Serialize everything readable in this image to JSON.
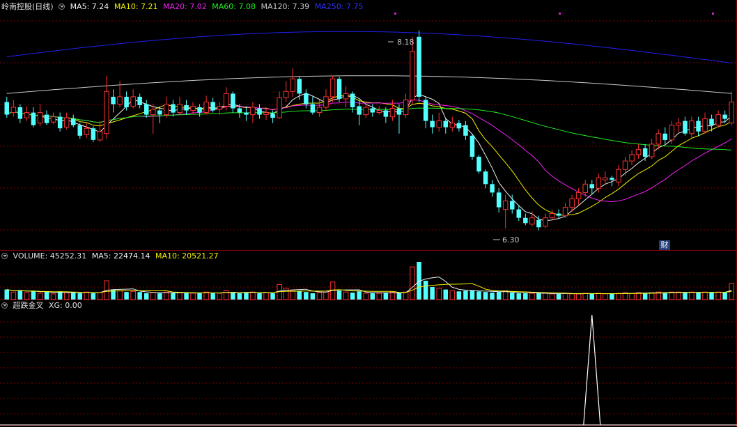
{
  "header": {
    "title": "岭南控股(日线)",
    "ma": [
      {
        "label": "MA5: 7.24",
        "color": "#f0f0f0"
      },
      {
        "label": "MA10: 7.21",
        "color": "#f0f000"
      },
      {
        "label": "MA20: 7.02",
        "color": "#f020f0"
      },
      {
        "label": "MA60: 7.08",
        "color": "#20f020"
      },
      {
        "label": "MA120: 7.39",
        "color": "#c8c8c8"
      },
      {
        "label": "MA250: 7.75",
        "color": "#2020f0"
      }
    ]
  },
  "volume_header": {
    "label": "VOLUME: 45252.31",
    "ma5": "MA5: 22474.14",
    "ma10": "MA10: 20521.27"
  },
  "indicator_header": {
    "name": "超跌金叉",
    "value": "XG: 0.00"
  },
  "annotations": {
    "high": "8.18",
    "low": "6.30",
    "finance_badge": "财"
  },
  "colors": {
    "up": "#ff3232",
    "down": "#54ffff",
    "grid": "#800000",
    "ma5": "#f0f0f0",
    "ma10": "#f0f000",
    "ma20": "#f020f0",
    "ma60": "#20f020",
    "ma120": "#c8c8c8",
    "ma250": "#2020f0"
  },
  "chart_data": {
    "type": "candlestick",
    "price_range": [
      6.1,
      8.35
    ],
    "candles": [
      [
        7.5,
        7.38,
        7.55,
        7.35
      ],
      [
        7.4,
        7.45,
        7.52,
        7.36
      ],
      [
        7.45,
        7.34,
        7.48,
        7.3
      ],
      [
        7.35,
        7.4,
        7.46,
        7.32
      ],
      [
        7.4,
        7.28,
        7.45,
        7.26
      ],
      [
        7.3,
        7.4,
        7.48,
        7.27
      ],
      [
        7.38,
        7.3,
        7.42,
        7.28
      ],
      [
        7.31,
        7.36,
        7.4,
        7.29
      ],
      [
        7.36,
        7.25,
        7.4,
        7.22
      ],
      [
        7.26,
        7.35,
        7.4,
        7.24
      ],
      [
        7.34,
        7.28,
        7.38,
        7.26
      ],
      [
        7.28,
        7.18,
        7.3,
        7.15
      ],
      [
        7.19,
        7.25,
        7.3,
        7.16
      ],
      [
        7.25,
        7.14,
        7.27,
        7.12
      ],
      [
        7.14,
        7.22,
        7.32,
        7.12
      ],
      [
        7.2,
        7.6,
        7.75,
        7.15
      ],
      [
        7.55,
        7.48,
        7.62,
        7.4
      ],
      [
        7.48,
        7.55,
        7.7,
        7.45
      ],
      [
        7.55,
        7.45,
        7.6,
        7.42
      ],
      [
        7.46,
        7.55,
        7.62,
        7.44
      ],
      [
        7.55,
        7.47,
        7.58,
        7.44
      ],
      [
        7.48,
        7.38,
        7.52,
        7.35
      ],
      [
        7.38,
        7.43,
        7.48,
        7.2
      ],
      [
        7.42,
        7.38,
        7.46,
        7.3
      ],
      [
        7.38,
        7.48,
        7.55,
        7.35
      ],
      [
        7.48,
        7.4,
        7.52,
        7.36
      ],
      [
        7.4,
        7.48,
        7.55,
        7.38
      ],
      [
        7.47,
        7.42,
        7.52,
        7.38
      ],
      [
        7.42,
        7.46,
        7.5,
        7.38
      ],
      [
        7.45,
        7.4,
        7.48,
        7.36
      ],
      [
        7.4,
        7.5,
        7.56,
        7.38
      ],
      [
        7.5,
        7.42,
        7.54,
        7.4
      ],
      [
        7.43,
        7.46,
        7.5,
        7.38
      ],
      [
        7.46,
        7.58,
        7.64,
        7.42
      ],
      [
        7.58,
        7.44,
        7.6,
        7.4
      ],
      [
        7.44,
        7.4,
        7.48,
        7.35
      ],
      [
        7.4,
        7.38,
        7.46,
        7.32
      ],
      [
        7.38,
        7.45,
        7.5,
        7.3
      ],
      [
        7.44,
        7.38,
        7.48,
        7.34
      ],
      [
        7.38,
        7.4,
        7.45,
        7.33
      ],
      [
        7.39,
        7.35,
        7.42,
        7.3
      ],
      [
        7.35,
        7.54,
        7.6,
        7.34
      ],
      [
        7.54,
        7.6,
        7.7,
        7.5
      ],
      [
        7.6,
        7.72,
        7.82,
        7.55
      ],
      [
        7.72,
        7.58,
        7.74,
        7.52
      ],
      [
        7.58,
        7.48,
        7.62,
        7.44
      ],
      [
        7.48,
        7.4,
        7.55,
        7.38
      ],
      [
        7.4,
        7.45,
        7.52,
        7.36
      ],
      [
        7.45,
        7.55,
        7.62,
        7.42
      ],
      [
        7.55,
        7.72,
        7.75,
        7.5
      ],
      [
        7.72,
        7.53,
        7.74,
        7.5
      ],
      [
        7.53,
        7.58,
        7.65,
        7.45
      ],
      [
        7.58,
        7.45,
        7.6,
        7.4
      ],
      [
        7.46,
        7.38,
        7.52,
        7.28
      ],
      [
        7.38,
        7.45,
        7.48,
        7.35
      ],
      [
        7.44,
        7.4,
        7.48,
        7.36
      ],
      [
        7.4,
        7.42,
        7.46,
        7.38
      ],
      [
        7.42,
        7.36,
        7.45,
        7.3
      ],
      [
        7.36,
        7.44,
        7.52,
        7.32
      ],
      [
        7.44,
        7.38,
        7.48,
        7.2
      ],
      [
        7.38,
        7.52,
        7.58,
        7.35
      ],
      [
        7.52,
        7.98,
        8.12,
        7.48
      ],
      [
        8.12,
        7.55,
        8.18,
        7.5
      ],
      [
        7.52,
        7.32,
        7.55,
        7.25
      ],
      [
        7.32,
        7.26,
        7.38,
        7.2
      ],
      [
        7.26,
        7.32,
        7.4,
        7.22
      ],
      [
        7.32,
        7.26,
        7.35,
        7.2
      ],
      [
        7.26,
        7.3,
        7.36,
        7.22
      ],
      [
        7.3,
        7.25,
        7.33,
        7.22
      ],
      [
        7.28,
        7.18,
        7.32,
        7.14
      ],
      [
        7.18,
        6.98,
        7.2,
        6.95
      ],
      [
        6.98,
        6.84,
        7.0,
        6.82
      ],
      [
        6.84,
        6.72,
        6.86,
        6.68
      ],
      [
        6.72,
        6.64,
        6.76,
        6.6
      ],
      [
        6.64,
        6.5,
        6.68,
        6.45
      ],
      [
        6.48,
        6.56,
        6.62,
        6.3
      ],
      [
        6.56,
        6.48,
        6.62,
        6.44
      ],
      [
        6.48,
        6.4,
        6.52,
        6.37
      ],
      [
        6.4,
        6.35,
        6.44,
        6.33
      ],
      [
        6.34,
        6.4,
        6.46,
        6.32
      ],
      [
        6.38,
        6.31,
        6.42,
        6.28
      ],
      [
        6.32,
        6.4,
        6.44,
        6.3
      ],
      [
        6.4,
        6.44,
        6.48,
        6.38
      ],
      [
        6.44,
        6.42,
        6.48,
        6.4
      ],
      [
        6.42,
        6.5,
        6.54,
        6.4
      ],
      [
        6.5,
        6.58,
        6.62,
        6.46
      ],
      [
        6.58,
        6.64,
        6.68,
        6.52
      ],
      [
        6.64,
        6.72,
        6.76,
        6.6
      ],
      [
        6.72,
        6.68,
        6.76,
        6.62
      ],
      [
        6.68,
        6.78,
        6.82,
        6.64
      ],
      [
        6.76,
        6.78,
        6.84,
        6.72
      ],
      [
        6.78,
        6.76,
        6.8,
        6.7
      ],
      [
        6.74,
        6.86,
        6.9,
        6.7
      ],
      [
        6.86,
        6.94,
        6.98,
        6.8
      ],
      [
        6.94,
        7.0,
        7.04,
        6.9
      ],
      [
        7.0,
        7.05,
        7.1,
        6.96
      ],
      [
        7.06,
        6.98,
        7.1,
        6.94
      ],
      [
        6.98,
        7.1,
        7.15,
        6.96
      ],
      [
        7.1,
        7.2,
        7.24,
        7.05
      ],
      [
        7.2,
        7.14,
        7.26,
        7.1
      ],
      [
        7.14,
        7.28,
        7.32,
        7.1
      ],
      [
        7.28,
        7.3,
        7.35,
        7.22
      ],
      [
        7.32,
        7.2,
        7.36,
        7.18
      ],
      [
        7.2,
        7.32,
        7.36,
        7.16
      ],
      [
        7.32,
        7.22,
        7.36,
        7.18
      ],
      [
        7.22,
        7.34,
        7.4,
        7.2
      ],
      [
        7.34,
        7.28,
        7.38,
        7.22
      ],
      [
        7.28,
        7.38,
        7.42,
        7.26
      ],
      [
        7.38,
        7.34,
        7.42,
        7.3
      ],
      [
        7.3,
        7.5,
        7.6,
        7.28
      ]
    ],
    "volumes": [
      16,
      12,
      15,
      11,
      14,
      10,
      12,
      9,
      13,
      11,
      12,
      10,
      12,
      10,
      11,
      30,
      16,
      14,
      12,
      13,
      12,
      10,
      11,
      10,
      12,
      10,
      11,
      10,
      10,
      11,
      12,
      10,
      10,
      14,
      12,
      10,
      11,
      12,
      10,
      11,
      10,
      24,
      18,
      14,
      14,
      12,
      10,
      11,
      12,
      28,
      14,
      12,
      11,
      13,
      10,
      10,
      10,
      11,
      12,
      10,
      12,
      52,
      60,
      30,
      20,
      18,
      16,
      14,
      13,
      14,
      15,
      13,
      12,
      11,
      12,
      14,
      11,
      10,
      10,
      10,
      10,
      10,
      9,
      9,
      10,
      9,
      9,
      10,
      9,
      10,
      9,
      9,
      10,
      11,
      10,
      11,
      10,
      11,
      12,
      11,
      12,
      12,
      11,
      12,
      11,
      12,
      11,
      12,
      12,
      26
    ],
    "xg_signal_index": 88
  }
}
